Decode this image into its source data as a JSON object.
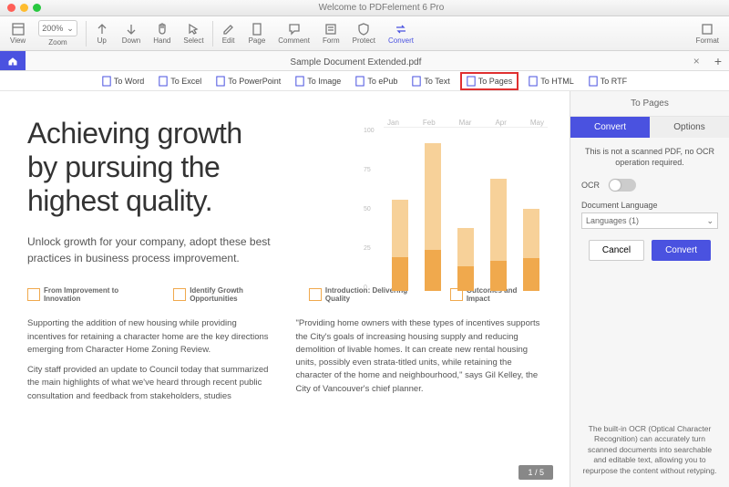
{
  "window": {
    "title": "Welcome to PDFelement 6 Pro"
  },
  "toolbar": {
    "view": "View",
    "zoom": "Zoom",
    "zoom_value": "200%",
    "up": "Up",
    "down": "Down",
    "hand": "Hand",
    "select": "Select",
    "edit": "Edit",
    "page": "Page",
    "comment": "Comment",
    "form": "Form",
    "protect": "Protect",
    "convert": "Convert",
    "format": "Format"
  },
  "tab": {
    "name": "Sample Document Extended.pdf"
  },
  "convert_opts": {
    "word": "To Word",
    "excel": "To Excel",
    "ppt": "To PowerPoint",
    "image": "To Image",
    "epub": "To ePub",
    "text": "To Text",
    "pages": "To Pages",
    "html": "To HTML",
    "rtf": "To RTF"
  },
  "panel": {
    "title": "To Pages",
    "tab_convert": "Convert",
    "tab_options": "Options",
    "note": "This is not a scanned PDF, no OCR operation required.",
    "ocr_label": "OCR",
    "lang_label": "Document Language",
    "lang_value": "Languages (1)",
    "cancel": "Cancel",
    "convert": "Convert",
    "footer": "The built-in OCR (Optical Character Recognition) can accurately turn scanned documents into searchable and editable text, allowing you to repurpose the content without retyping."
  },
  "doc": {
    "h1a": "Achieving growth",
    "h1b": "by pursuing the",
    "h1c": "highest quality.",
    "sub": "Unlock growth for your company, adopt these best practices in business process improvement.",
    "feat1": "From Improvement to Innovation",
    "feat2": "Identify Growth Opportunities",
    "feat3": "Introduction: Delivering Quality",
    "feat4": "Outcomes and Impact",
    "col1p1": "Supporting the addition of new housing while providing incentives for retaining a character home are the key directions emerging from Character Home Zoning Review.",
    "col1p2": "City staff provided an update to Council today that summarized the main highlights of what we've heard through recent public consultation and feedback from stakeholders, studies",
    "col2p1": "\"Providing home owners with these types of incentives supports the City's goals of increasing housing supply and reducing demolition of livable homes.  It can create new rental housing units, possibly even strata-titled units, while retaining the character of the home and neighbourhood,\" says Gil Kelley, the City of Vancouver's chief planner.",
    "page_indicator": "1 / 5"
  },
  "chart_data": {
    "type": "bar",
    "categories": [
      "Jan",
      "Feb",
      "Mar",
      "Apr",
      "May"
    ],
    "ylim": [
      0,
      120
    ],
    "yticks": [
      0,
      25,
      50,
      75,
      100
    ],
    "series": [
      {
        "name": "lower",
        "color": "#f0a94d",
        "values": [
          25,
          30,
          18,
          22,
          24
        ]
      },
      {
        "name": "upper",
        "color": "#f7d199",
        "values": [
          42,
          78,
          28,
          60,
          36
        ]
      }
    ]
  }
}
